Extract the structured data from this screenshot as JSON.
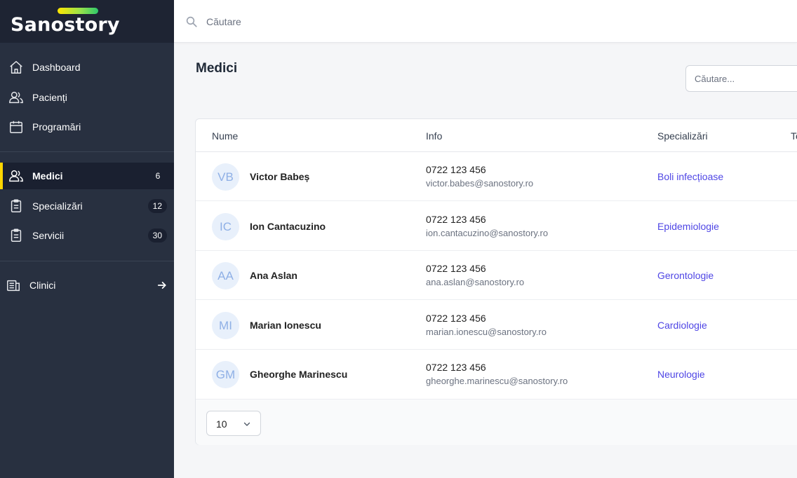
{
  "brand": {
    "name": "Sanostory"
  },
  "topbar": {
    "search_placeholder": "Căutare"
  },
  "sidebar": {
    "items": [
      {
        "label": "Dashboard",
        "icon": "home-icon"
      },
      {
        "label": "Pacienți",
        "icon": "users-icon"
      },
      {
        "label": "Programări",
        "icon": "calendar-icon"
      },
      {
        "label": "Medici",
        "icon": "users-icon",
        "count": "6",
        "active": true
      },
      {
        "label": "Specializări",
        "icon": "clipboard-icon",
        "count": "12"
      },
      {
        "label": "Servicii",
        "icon": "clipboard-icon",
        "count": "30"
      },
      {
        "label": "Clinici",
        "icon": "building-icon",
        "trailing_icon": "arrow-right-icon"
      }
    ]
  },
  "main": {
    "title": "Medici",
    "search_placeholder": "Căutare...",
    "columns": [
      "Nume",
      "Info",
      "Specializări",
      "Te"
    ],
    "rows": [
      {
        "initials": "VB",
        "name": "Victor Babeș",
        "phone": "0722 123 456",
        "email": "victor.babes@sanostory.ro",
        "specialization": "Boli infecțioase"
      },
      {
        "initials": "IC",
        "name": "Ion Cantacuzino",
        "phone": "0722 123 456",
        "email": "ion.cantacuzino@sanostory.ro",
        "specialization": "Epidemiologie"
      },
      {
        "initials": "AA",
        "name": "Ana Aslan",
        "phone": "0722 123 456",
        "email": "ana.aslan@sanostory.ro",
        "specialization": "Gerontologie"
      },
      {
        "initials": "MI",
        "name": "Marian Ionescu",
        "phone": "0722 123 456",
        "email": "marian.ionescu@sanostory.ro",
        "specialization": "Cardiologie"
      },
      {
        "initials": "GM",
        "name": "Gheorghe Marinescu",
        "phone": "0722 123 456",
        "email": "gheorghe.marinescu@sanostory.ro",
        "specialization": "Neurologie"
      }
    ],
    "page_size": "10"
  },
  "colors": {
    "sidebar_bg": "#283040",
    "active_accent": "#ffd600",
    "link": "#4f46e5"
  }
}
